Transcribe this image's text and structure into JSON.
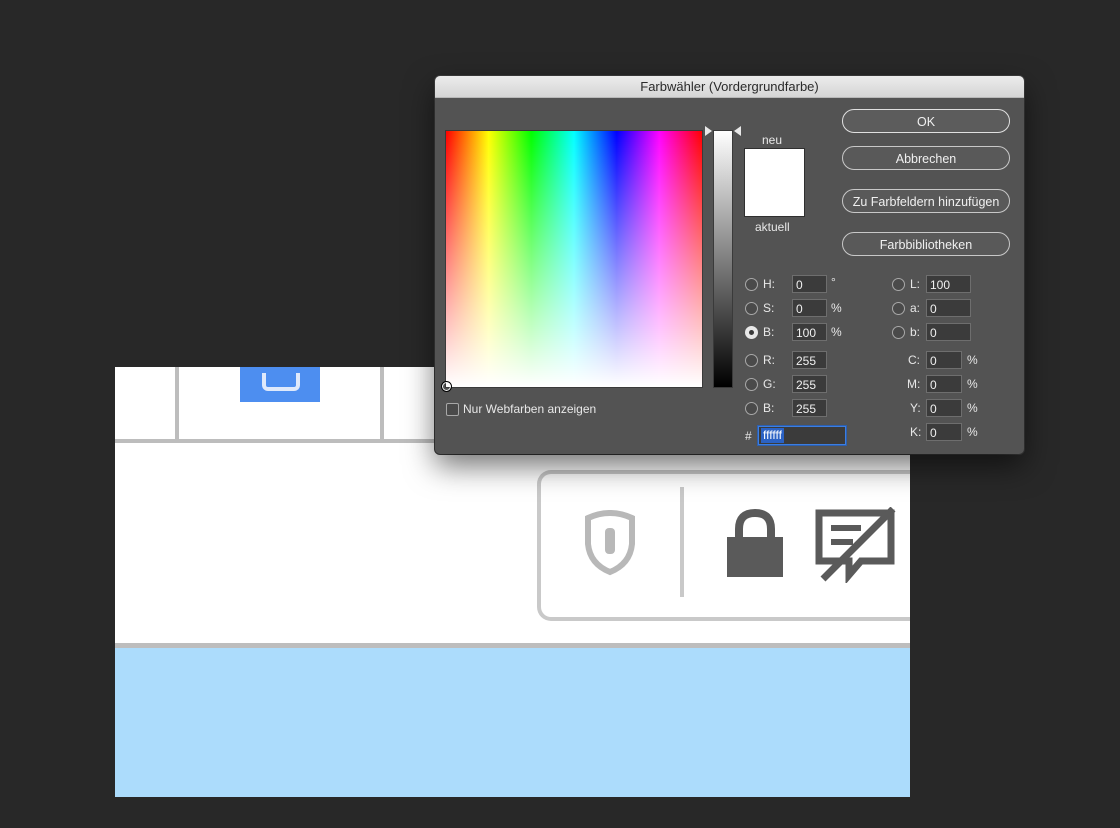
{
  "dialog": {
    "title": "Farbwähler (Vordergrundfarbe)",
    "new_label": "neu",
    "current_label": "aktuell",
    "new_color": "#ffffff",
    "current_color": "#ffffff",
    "web_colors_only": "Nur Webfarben anzeigen",
    "buttons": {
      "ok": "OK",
      "cancel": "Abbrechen",
      "add_swatches": "Zu Farbfeldern hinzufügen",
      "libraries": "Farbbibliotheken"
    },
    "hsb": {
      "h_label": "H:",
      "h_value": "0",
      "h_unit": "°",
      "s_label": "S:",
      "s_value": "0",
      "s_unit": "%",
      "b_label": "B:",
      "b_value": "100",
      "b_unit": "%"
    },
    "rgb": {
      "r_label": "R:",
      "r_value": "255",
      "g_label": "G:",
      "g_value": "255",
      "b_label": "B:",
      "b_value": "255"
    },
    "lab": {
      "l_label": "L:",
      "l_value": "100",
      "a_label": "a:",
      "a_value": "0",
      "b_label": "b:",
      "b_value": "0"
    },
    "cmyk": {
      "c_label": "C:",
      "c_value": "0",
      "m_label": "M:",
      "m_value": "0",
      "y_label": "Y:",
      "y_value": "0",
      "k_label": "K:",
      "k_value": "0",
      "unit": "%"
    },
    "hex": {
      "prefix": "#",
      "value": "ffffff"
    },
    "selected_mode": "B"
  },
  "background": {
    "canvas_color": "#ffffff",
    "band_color": "#acdcfc",
    "tile_color": "#4d8ef0"
  }
}
